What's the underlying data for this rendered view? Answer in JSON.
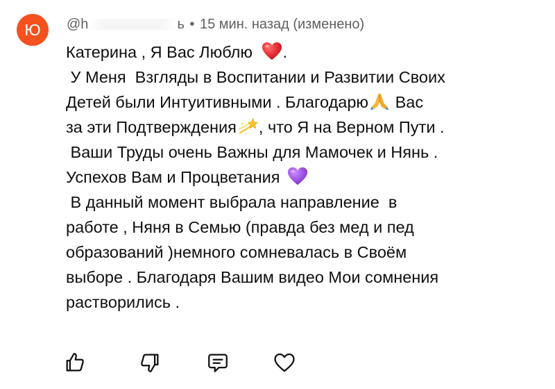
{
  "comment": {
    "avatar_letter": "Ю",
    "avatar_color": "#f4511e",
    "author_visible_prefix": "@h",
    "author_visible_suffix": "ь",
    "separator": "•",
    "timestamp": "15 мин. назад (изменено)",
    "lines": [
      "Катерина , Я Вас Люблю",
      ".",
      " У Меня  Взгляды в Воспитании и Развитии Своих",
      "Детей были Интуитивными . Благодарю",
      " Вас",
      "за эти Подтверждения",
      ", что Я на Верном Пути .",
      " Ваши Труды очень Важны для Мамочек и Нянь .",
      "Успехов Вам и Процветания",
      " В данный момент выбрала направление  в",
      "работе , Няня в Семью (правда без мед и пед",
      "образований )немного сомневалась в Своём",
      "выборе . Благодаря Вашим видео Мои сомнения",
      "растворились ."
    ],
    "emojis": {
      "heart": "red-heart-emoji",
      "pray": "folded-hands-emoji",
      "dizzy": "dizzy-star-emoji",
      "purple_heart": "purple-heart-emoji"
    },
    "colors": {
      "text": "#0f0f0f",
      "meta": "#606060",
      "icon": "#0f0f0f",
      "heart_red": "#e0282e",
      "purple": "#9b4fe0"
    }
  },
  "actions": [
    {
      "name": "like-button",
      "icon": "thumbs-up-icon"
    },
    {
      "name": "dislike-button",
      "icon": "thumbs-down-icon"
    },
    {
      "name": "reply-button",
      "icon": "comment-icon"
    },
    {
      "name": "heart-button",
      "icon": "heart-outline-icon"
    }
  ]
}
